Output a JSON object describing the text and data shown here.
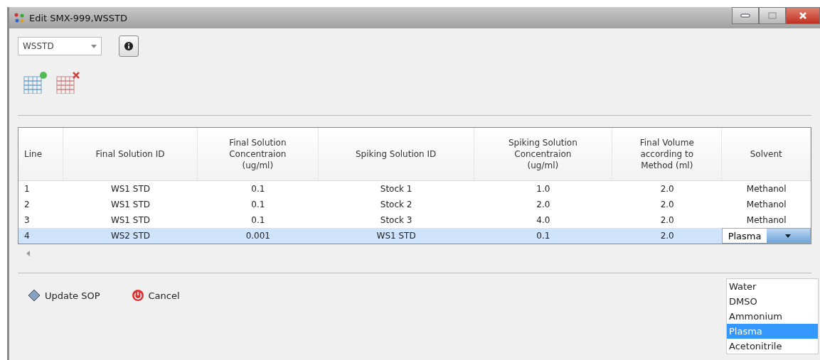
{
  "window": {
    "title": "Edit SMX-999,WSSTD"
  },
  "selector": {
    "value": "WSSTD"
  },
  "table": {
    "columns": [
      "Line",
      "Final Solution ID",
      "Final Solution Concentraion (ug/ml)",
      "Spiking Solution ID",
      "Spiking Solution Concentraion (ug/ml)",
      "Final Volume according to Method (ml)",
      "Solvent"
    ],
    "rows": [
      {
        "selected": false,
        "cells": [
          "1",
          "WS1 STD",
          "0.1",
          "Stock 1",
          "1.0",
          "2.0",
          "Methanol"
        ],
        "kind": "text"
      },
      {
        "selected": false,
        "cells": [
          "2",
          "WS1 STD",
          "0.1",
          "Stock 2",
          "2.0",
          "2.0",
          "Methanol"
        ],
        "kind": "text"
      },
      {
        "selected": false,
        "cells": [
          "3",
          "WS1 STD",
          "0.1",
          "Stock 3",
          "4.0",
          "2.0",
          "Methanol"
        ],
        "kind": "text"
      },
      {
        "selected": true,
        "cells": [
          "4",
          "WS2 STD",
          "0.001",
          "WS1 STD",
          "0.1",
          "2.0",
          "Plasma"
        ],
        "kind": "combo"
      }
    ]
  },
  "dropdown": {
    "options": [
      {
        "label": "Water",
        "selected": false
      },
      {
        "label": "DMSO",
        "selected": false
      },
      {
        "label": "Ammonium",
        "selected": false
      },
      {
        "label": "Plasma",
        "selected": true
      },
      {
        "label": "Acetonitrile",
        "selected": false
      }
    ]
  },
  "buttons": [
    {
      "label": "Update SOP",
      "kind": "update"
    },
    {
      "label": "Cancel",
      "kind": "cancel"
    }
  ]
}
